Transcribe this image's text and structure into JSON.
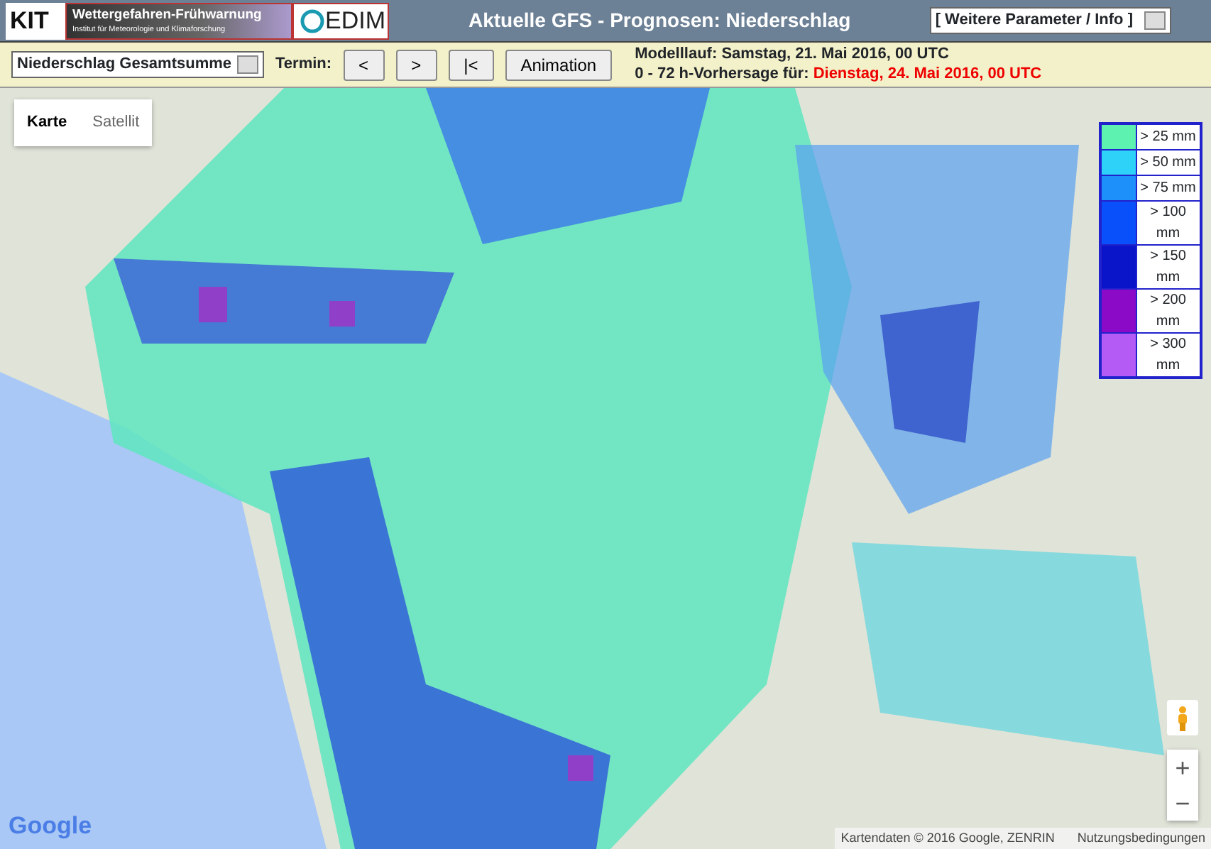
{
  "header": {
    "logos": [
      {
        "kind": "kit",
        "text": "KIT"
      },
      {
        "kind": "banner",
        "text": "Wettergefahren-Frühwarnung",
        "subtext": "Institut für Meteorologie und Klimaforschung"
      },
      {
        "kind": "cedim",
        "text": "EDIM"
      }
    ],
    "title": "Aktuelle GFS - Prognosen: Niederschlag",
    "menu": {
      "value": "[ Weitere Parameter / Info ]"
    }
  },
  "toolbar": {
    "parameter": {
      "value": "Niederschlag Gesamtsumme"
    },
    "termin_label": "Termin:",
    "buttons": [
      {
        "label": "<"
      },
      {
        "label": ">"
      },
      {
        "label": "|<"
      },
      {
        "label": "Animation"
      }
    ],
    "run_label": "Modelllauf:",
    "run_value": "Samstag, 21. Mai 2016, 00 UTC",
    "forecast_label": "0 - 72 h-Vorhersage für:",
    "forecast_value": "Dienstag, 24. Mai 2016, 00 UTC"
  },
  "map": {
    "map_types": [
      {
        "label": "Karte",
        "selected": true
      },
      {
        "label": "Satellit",
        "selected": false
      }
    ],
    "legend": [
      {
        "label": "> 25 mm",
        "color": "#5ef2b0"
      },
      {
        "label": "> 50 mm",
        "color": "#2ed2f8"
      },
      {
        "label": "> 75 mm",
        "color": "#1e90fa"
      },
      {
        "label": "> 100 mm",
        "color": "#0a50fa"
      },
      {
        "label": "> 150 mm",
        "color": "#0a14c8"
      },
      {
        "label": "> 200 mm",
        "color": "#8a0ac8"
      },
      {
        "label": "> 300 mm",
        "color": "#b45af5"
      }
    ],
    "zoom_in": "+",
    "zoom_out": "−",
    "google": "Google",
    "attribution": "Kartendaten © 2016 Google, ZENRIN",
    "terms": "Nutzungsbedingungen"
  }
}
